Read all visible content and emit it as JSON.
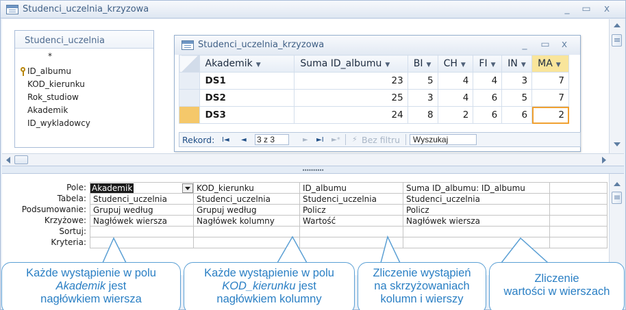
{
  "window": {
    "title": "Studenci_uczelnia_krzyzowa"
  },
  "table_box": {
    "title": "Studenci_uczelnia",
    "fields": [
      "*",
      "ID_albumu",
      "KOD_kierunku",
      "Rok_studiow",
      "Akademik",
      "ID_wykladowcy"
    ]
  },
  "datasheet": {
    "title": "Studenci_uczelnia_krzyzowa",
    "columns": [
      "Akademik",
      "Suma ID_albumu",
      "BI",
      "CH",
      "FI",
      "IN",
      "MA"
    ],
    "rows": [
      [
        "DS1",
        "23",
        "5",
        "4",
        "4",
        "3",
        "7"
      ],
      [
        "DS2",
        "25",
        "3",
        "4",
        "6",
        "5",
        "7"
      ],
      [
        "DS3",
        "24",
        "8",
        "2",
        "6",
        "6",
        "2"
      ]
    ],
    "nav": {
      "record_label": "Rekord:",
      "first": "H",
      "prev": "◄",
      "current": "3 z 3",
      "next": "►",
      "last": "►H",
      "new": "►",
      "filter": "Bez filtru",
      "search": "Wyszukaj"
    }
  },
  "qbe": {
    "row_labels": [
      "Pole:",
      "Tabela:",
      "Podsumowanie:",
      "Krzyżowe:",
      "Sortuj:",
      "Kryteria:"
    ],
    "columns": [
      [
        "Akademik",
        "Studenci_uczelnia",
        "Grupuj według",
        "Nagłówek wiersza",
        "",
        ""
      ],
      [
        "KOD_kierunku",
        "Studenci_uczelnia",
        "Grupuj według",
        "Nagłówek kolumny",
        "",
        ""
      ],
      [
        "ID_albumu",
        "Studenci_uczelnia",
        "Policz",
        "Wartość",
        "",
        ""
      ],
      [
        "Suma ID_albumu: ID_albumu",
        "Studenci_uczelnia",
        "Policz",
        "Nagłówek wiersza",
        "",
        ""
      ],
      [
        "",
        "",
        "",
        "",
        "",
        ""
      ]
    ]
  },
  "callouts": {
    "c1": {
      "line1": "Każde wystąpienie w polu",
      "line2_em": "Akademik",
      "line2_rest": " jest",
      "line3": "nagłówkiem wiersza"
    },
    "c2": {
      "line1": "Każde wystąpienie w polu",
      "line2_em": "KOD_kierunku",
      "line2_rest": " jest",
      "line3": "nagłówkiem kolumny"
    },
    "c3": {
      "line1": "Zliczenie wystąpień",
      "line2": "na skrzyżowaniach",
      "line3": "kolumn i wierszy"
    },
    "c4": {
      "line1": "Zliczenie",
      "line2": "wartości w wierszach"
    }
  },
  "colors": {
    "accent": "#2a7fc4",
    "highlight": "#f9e59b"
  }
}
